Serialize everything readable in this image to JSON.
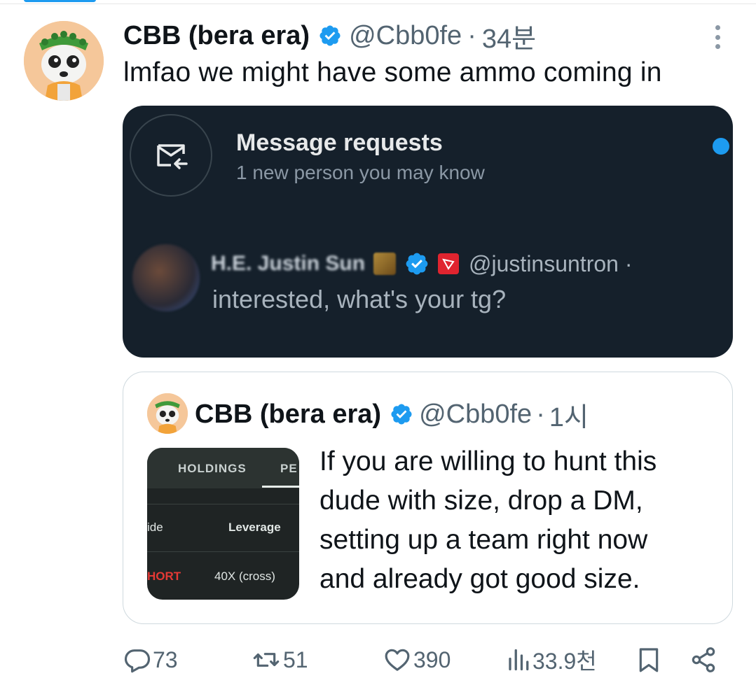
{
  "tweet": {
    "display_name": "CBB (bera era)",
    "handle": "@Cbb0fe",
    "separator": "·",
    "time": "34분",
    "text": "lmfao we might have some ammo coming in"
  },
  "dm_screenshot": {
    "title": "Message requests",
    "subtitle": "1 new person you may know",
    "sender_name": "H.E. Justin Sun",
    "sender_handle": "@justinsuntron ·",
    "message": "interested, what's your tg?"
  },
  "quote": {
    "display_name": "CBB (bera era)",
    "handle": "@Cbb0fe",
    "separator": "·",
    "time": "1시",
    "lines": [
      "If you are willing to hunt this",
      "dude with size, drop a DM,",
      "setting up a team right now",
      "and already got good size."
    ],
    "thumbnail": {
      "tab_active": "HOLDINGS",
      "tab_next": "PE",
      "col_side": "ide",
      "col_leverage": "Leverage",
      "val_side": "HORT",
      "val_leverage": "40X (cross)"
    }
  },
  "actions": {
    "replies": "73",
    "retweets": "51",
    "likes": "390",
    "views": "33.9천"
  },
  "colors": {
    "accent": "#1d9bf0",
    "text_primary": "#0f1419",
    "text_secondary": "#536471",
    "dm_background": "#15202b",
    "short_red": "#e53935"
  }
}
